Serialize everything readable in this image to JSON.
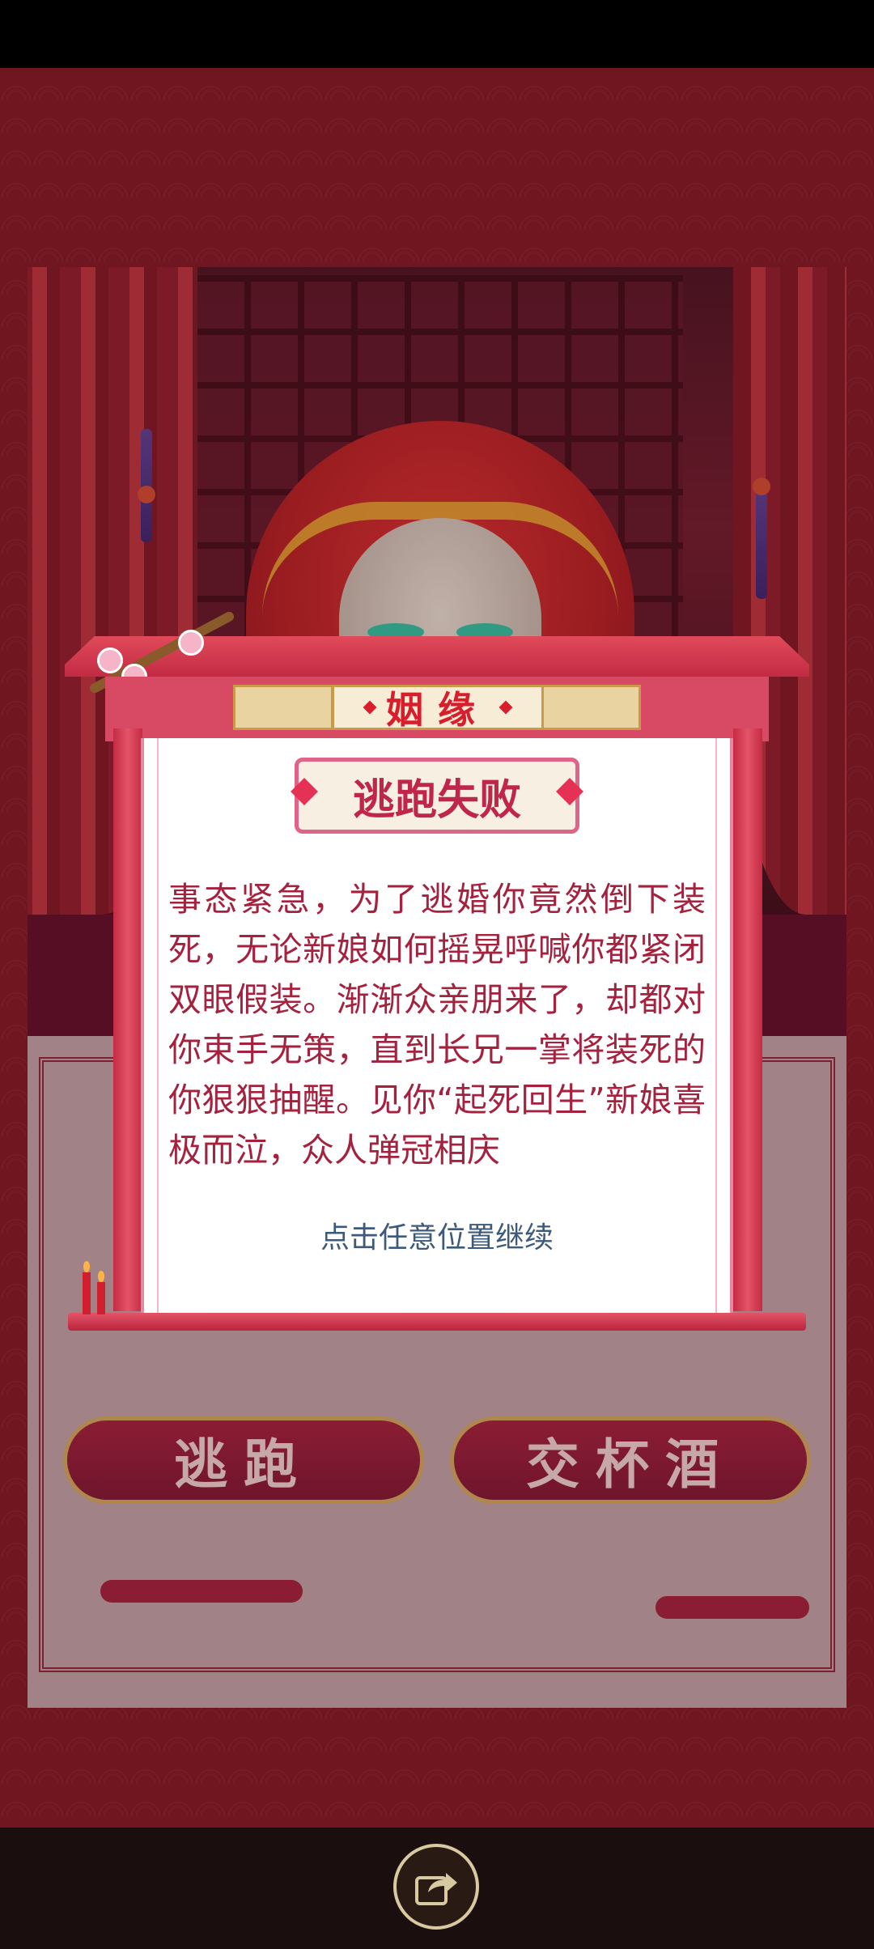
{
  "dialog": {
    "banner_title": "姻缘",
    "result_title": "逃跑失败",
    "story": "事态紧急，为了逃婚你竟然倒下装死，无论新娘如何摇晃呼喊你都紧闭双眼假装。渐渐众亲朋来了，却都对你束手无策，直到长兄一掌将装死的你狠狠抽醒。见你“起死回生”新娘喜极而泣，众人弹冠相庆",
    "hint": "点击任意位置继续"
  },
  "choices": {
    "run_label": "逃跑",
    "toast_label": "交杯酒"
  },
  "bottom": {
    "share_icon": "share-icon"
  },
  "colors": {
    "frame_red": "#7a1622",
    "accent_pink": "#e0638a",
    "title_red": "#d81e2c",
    "story_text": "#a4223e",
    "hint_text": "#3d5a7a"
  }
}
